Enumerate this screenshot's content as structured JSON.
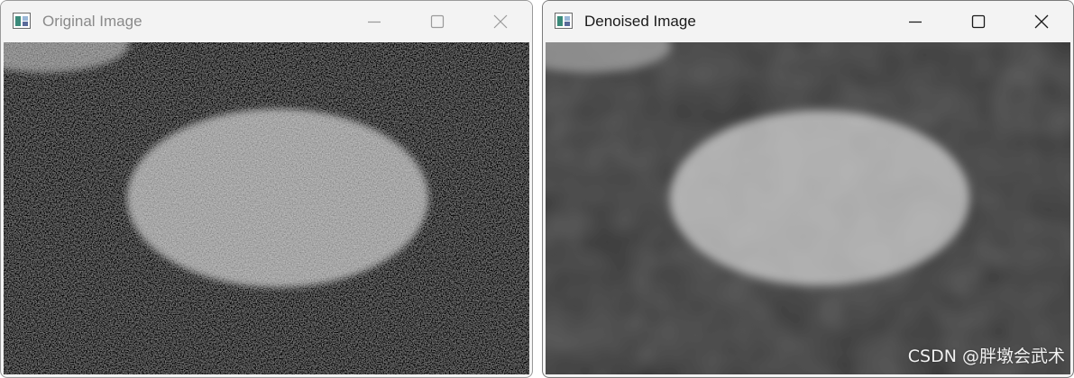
{
  "windows": {
    "original": {
      "title": "Original Image",
      "active": false
    },
    "denoised": {
      "title": "Denoised Image",
      "active": true
    }
  },
  "caption_buttons": [
    "minimize-icon",
    "maximize-icon",
    "close-icon"
  ],
  "colors": {
    "titlebar_bg": "#f3f3f3",
    "inactive_title": "#8a8a8a",
    "active_title": "#1a1a1a",
    "image_background_noisy": "#3a3a3a",
    "image_background_smooth": "#404040",
    "ellipse_noisy": "#b4b4b4",
    "ellipse_smooth": "#b0b0b0"
  },
  "watermark": "CSDN @胖墩会武术"
}
